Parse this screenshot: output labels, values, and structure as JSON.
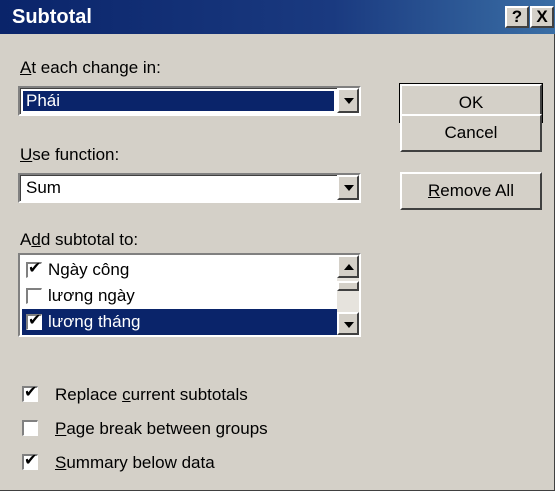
{
  "window": {
    "title": "Subtotal",
    "help_label": "?",
    "close_label": "X"
  },
  "change_in": {
    "label_prefix": "",
    "label_accel": "A",
    "label_rest": "t each change in:",
    "value": "Phái"
  },
  "function": {
    "label_accel": "U",
    "label_rest": "se function:",
    "value": "Sum"
  },
  "add_subtotal": {
    "label_pre": "A",
    "label_accel": "d",
    "label_rest": "d subtotal to:",
    "items": [
      {
        "label": "Ngày công",
        "checked": true,
        "selected": false
      },
      {
        "label": "lương ngày",
        "checked": false,
        "selected": false
      },
      {
        "label": "lương tháng",
        "checked": true,
        "selected": true
      }
    ]
  },
  "buttons": {
    "ok": "OK",
    "cancel": "Cancel",
    "remove_all_accel": "R",
    "remove_all_rest": "emove All"
  },
  "options": {
    "replace": {
      "pre": "Replace ",
      "accel": "c",
      "rest": "urrent subtotals",
      "checked": true
    },
    "page_break": {
      "pre": "",
      "accel": "P",
      "rest": "age break between groups",
      "checked": false
    },
    "summary": {
      "pre": "",
      "accel": "S",
      "rest": "ummary below data",
      "checked": true
    }
  },
  "checkmark": "✔"
}
